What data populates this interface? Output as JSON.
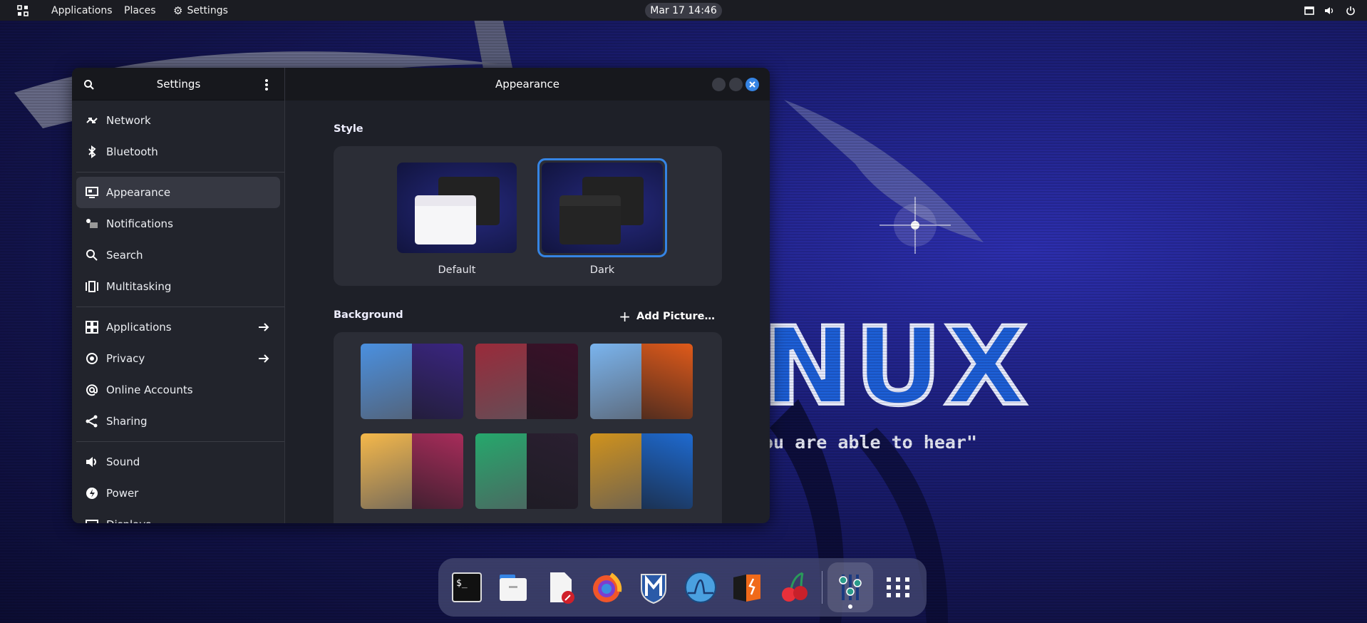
{
  "wallpaper": {
    "logo_text": "NUX",
    "motto": "ou are able to hear\""
  },
  "topbar": {
    "activities_icon": "grid-icon",
    "applications": "Applications",
    "places": "Places",
    "settings": "Settings",
    "clock": "Mar 17  14:46",
    "status_icons": [
      "screen-icon",
      "volume-icon",
      "power-icon"
    ]
  },
  "window": {
    "sidebar_title": "Settings",
    "title": "Appearance",
    "accent": "#3584e4",
    "sidebar": [
      {
        "label": "Network",
        "icon": "network-icon"
      },
      {
        "label": "Bluetooth",
        "icon": "bluetooth-icon"
      },
      {
        "sep": true
      },
      {
        "label": "Appearance",
        "icon": "appearance-icon",
        "selected": true
      },
      {
        "label": "Notifications",
        "icon": "notifications-icon"
      },
      {
        "label": "Search",
        "icon": "search-icon"
      },
      {
        "label": "Multitasking",
        "icon": "multitasking-icon"
      },
      {
        "sep": true
      },
      {
        "label": "Applications",
        "icon": "applications-icon",
        "arrow": true
      },
      {
        "label": "Privacy",
        "icon": "privacy-icon",
        "arrow": true
      },
      {
        "label": "Online Accounts",
        "icon": "at-icon"
      },
      {
        "label": "Sharing",
        "icon": "share-icon"
      },
      {
        "sep": true
      },
      {
        "label": "Sound",
        "icon": "sound-icon"
      },
      {
        "label": "Power",
        "icon": "power-icon"
      },
      {
        "label": "Displays",
        "icon": "display-icon"
      }
    ],
    "style": {
      "heading": "Style",
      "options": [
        {
          "label": "Default",
          "selected": false
        },
        {
          "label": "Dark",
          "selected": true
        }
      ]
    },
    "background": {
      "heading": "Background",
      "add_label": "Add Picture…",
      "thumbs": [
        {
          "left": "#4a90e0",
          "right": "#3a2580"
        },
        {
          "left": "#9a2a3a",
          "right": "#3a1028"
        },
        {
          "left": "#7ab4ee",
          "right": "#e05a1a"
        },
        {
          "left": "#f5b84a",
          "right": "#a82c5a"
        },
        {
          "left": "#25a86c",
          "right": "#2a1f30"
        },
        {
          "left": "#d0921c",
          "right": "#1e6ad0"
        }
      ]
    }
  },
  "dock": {
    "apps": [
      "terminal-icon",
      "files-icon",
      "text-editor-icon",
      "firefox-icon",
      "metasploit-icon",
      "wireshark-icon",
      "burpsuite-icon",
      "cherrytree-icon",
      "settings-app-icon",
      "show-apps-icon"
    ],
    "active": "settings-app-icon"
  }
}
